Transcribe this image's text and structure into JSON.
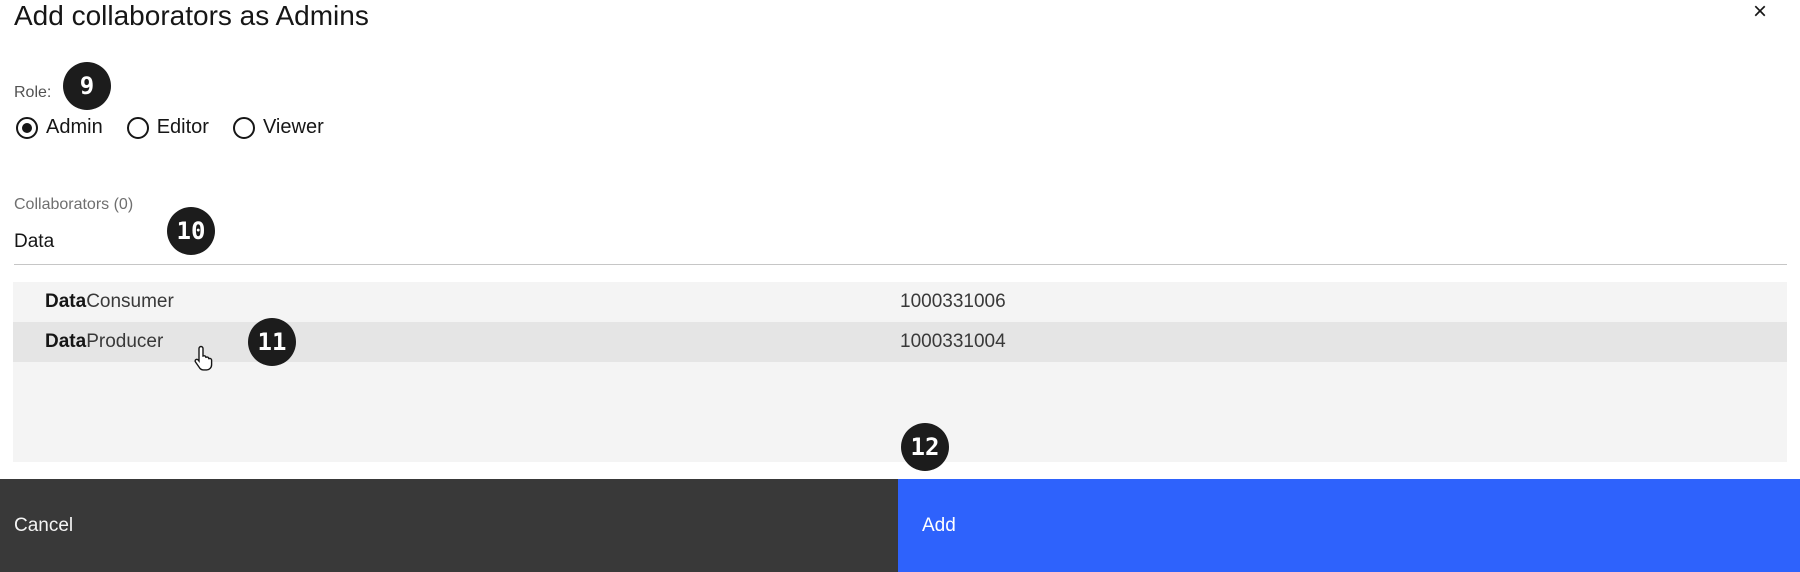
{
  "dialog": {
    "title": "Add collaborators as Admins",
    "close_icon": "×"
  },
  "role": {
    "label": "Role:",
    "options": [
      {
        "label": "Admin",
        "selected": true
      },
      {
        "label": "Editor",
        "selected": false
      },
      {
        "label": "Viewer",
        "selected": false
      }
    ]
  },
  "collaborators": {
    "label": "Collaborators (0)",
    "search_value": "Data",
    "results": [
      {
        "match": "Data",
        "rest": "Consumer",
        "id": "1000331006",
        "hovered": false
      },
      {
        "match": "Data",
        "rest": "Producer",
        "id": "1000331004",
        "hovered": true
      }
    ]
  },
  "footer": {
    "cancel_label": "Cancel",
    "add_label": "Add",
    "add_color": "#2e62fc",
    "cancel_color": "#393939"
  },
  "step_badges": [
    "9",
    "10",
    "11",
    "12"
  ]
}
